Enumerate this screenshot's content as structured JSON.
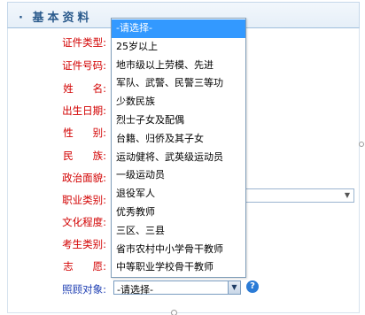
{
  "section": {
    "title": "基本资料",
    "bullet": "·"
  },
  "form": {
    "labels": [
      "证件类型:",
      "证件号码:",
      "姓      名:",
      "出生日期:",
      "性      别:",
      "民      族:",
      "政治面貌:",
      "职业类别:",
      "文化程度:",
      "考生类别:",
      "志      愿:"
    ],
    "care_label": "照顾对象:",
    "care_value": "-请选择-",
    "help_glyph": "?"
  },
  "dropdown": {
    "options": [
      "-请选择-",
      "25岁以上",
      "地市级以上劳模、先进",
      "军队、武警、民警三等功",
      "少数民族",
      "烈士子女及配偶",
      "台籍、归侨及其子女",
      "运动健将、武英级运动员",
      "一级运动员",
      "退役军人",
      "优秀教师",
      "三区、三县",
      "省市农村中小学骨干教师",
      "中等职业学校骨干教师"
    ],
    "selected_index": 0
  },
  "colors": {
    "label_red": "#d20000",
    "label_blue": "#1f3fb3",
    "selection_blue": "#3399ff",
    "header_text": "#2a5a8c"
  },
  "icons": {
    "dropdown_arrow": "chevron-down-icon",
    "help": "help-icon"
  }
}
